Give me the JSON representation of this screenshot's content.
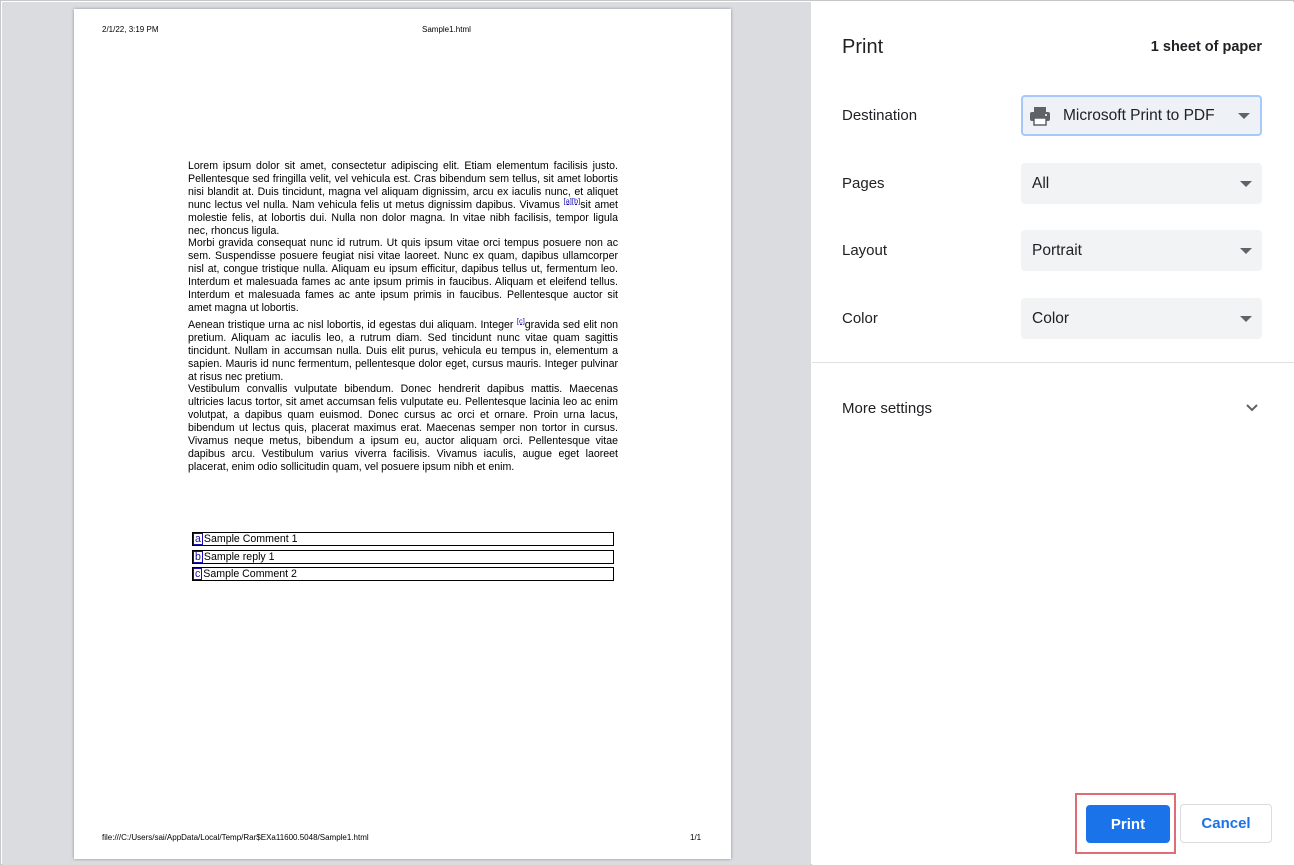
{
  "preview": {
    "header_date": "2/1/22, 3:19 PM",
    "header_title": "Sample1.html",
    "footer_path": "file:///C:/Users/sai/AppData/Local/Temp/Rar$EXa11600.5048/Sample1.html",
    "footer_page": "1/1",
    "paragraphs": {
      "p1a": "Lorem ipsum dolor sit amet, consectetur adipiscing elit. Etiam elementum facilisis justo. Pellentesque sed fringilla velit, vel vehicula est. Cras bibendum sem tellus, sit amet lobortis nisi blandit at. Duis tincidunt, magna vel aliquam dignissim, arcu ex iaculis nunc, et aliquet nunc lectus vel nulla. Nam vehicula felis ut metus dignissim dapibus. Vivamus ",
      "ref_a": "[a]",
      "ref_b": "[b]",
      "p1b": "sit amet molestie felis, at lobortis dui. Nulla non dolor magna. In vitae nibh facilisis, tempor ligula nec, rhoncus ligula.",
      "p2": "Morbi gravida consequat nunc id rutrum. Ut quis ipsum vitae orci tempus posuere non ac sem. Suspendisse posuere feugiat nisi vitae laoreet. Nunc ex quam, dapibus ullamcorper nisl at, congue tristique nulla. Aliquam eu ipsum efficitur, dapibus tellus ut, fermentum leo. Interdum et malesuada fames ac ante ipsum primis in faucibus. Aliquam et eleifend tellus. Interdum et malesuada fames ac ante ipsum primis in faucibus. Pellentesque auctor sit amet magna ut lobortis.",
      "p3a": "Aenean tristique urna ac nisl lobortis, id egestas dui aliquam. Integer ",
      "ref_c": "[c]",
      "p3b": "gravida sed elit non pretium. Aliquam ac iaculis leo, a rutrum diam. Sed tincidunt nunc vitae quam sagittis tincidunt. Nullam in accumsan nulla. Duis elit purus, vehicula eu tempus in, elementum a sapien. Mauris id nunc fermentum, pellentesque dolor eget, cursus mauris. Integer pulvinar at risus nec pretium.",
      "p4": "Vestibulum convallis vulputate bibendum. Donec hendrerit dapibus mattis. Maecenas ultricies lacus tortor, sit amet accumsan felis vulputate eu. Pellentesque lacinia leo ac enim volutpat, a dapibus quam euismod. Donec cursus ac orci et ornare. Proin urna lacus, bibendum ut lectus quis, placerat maximus erat. Maecenas semper non tortor in cursus. Vivamus neque metus, bibendum a ipsum eu, auctor aliquam orci. Pellentesque vitae dapibus arcu. Vestibulum varius viverra facilisis. Vivamus iaculis, augue eget laoreet placerat, enim odio sollicitudin quam, vel posuere ipsum nibh et enim."
    },
    "comments": [
      {
        "label": "a",
        "text": "Sample Comment 1"
      },
      {
        "label": "b",
        "text": "Sample reply 1"
      },
      {
        "label": "c",
        "text": "Sample Comment 2"
      }
    ]
  },
  "panel": {
    "title": "Print",
    "sheet_count": "1 sheet of paper",
    "destination": {
      "label": "Destination",
      "value": "Microsoft Print to PDF",
      "icon": "printer-icon"
    },
    "pages": {
      "label": "Pages",
      "value": "All"
    },
    "layout": {
      "label": "Layout",
      "value": "Portrait"
    },
    "color": {
      "label": "Color",
      "value": "Color"
    },
    "more_settings": {
      "label": "More settings",
      "icon": "chevron-down-icon"
    },
    "print_button": "Print",
    "cancel_button": "Cancel",
    "accent_color": "#1a73e8",
    "highlight_color": "#e06c75"
  }
}
